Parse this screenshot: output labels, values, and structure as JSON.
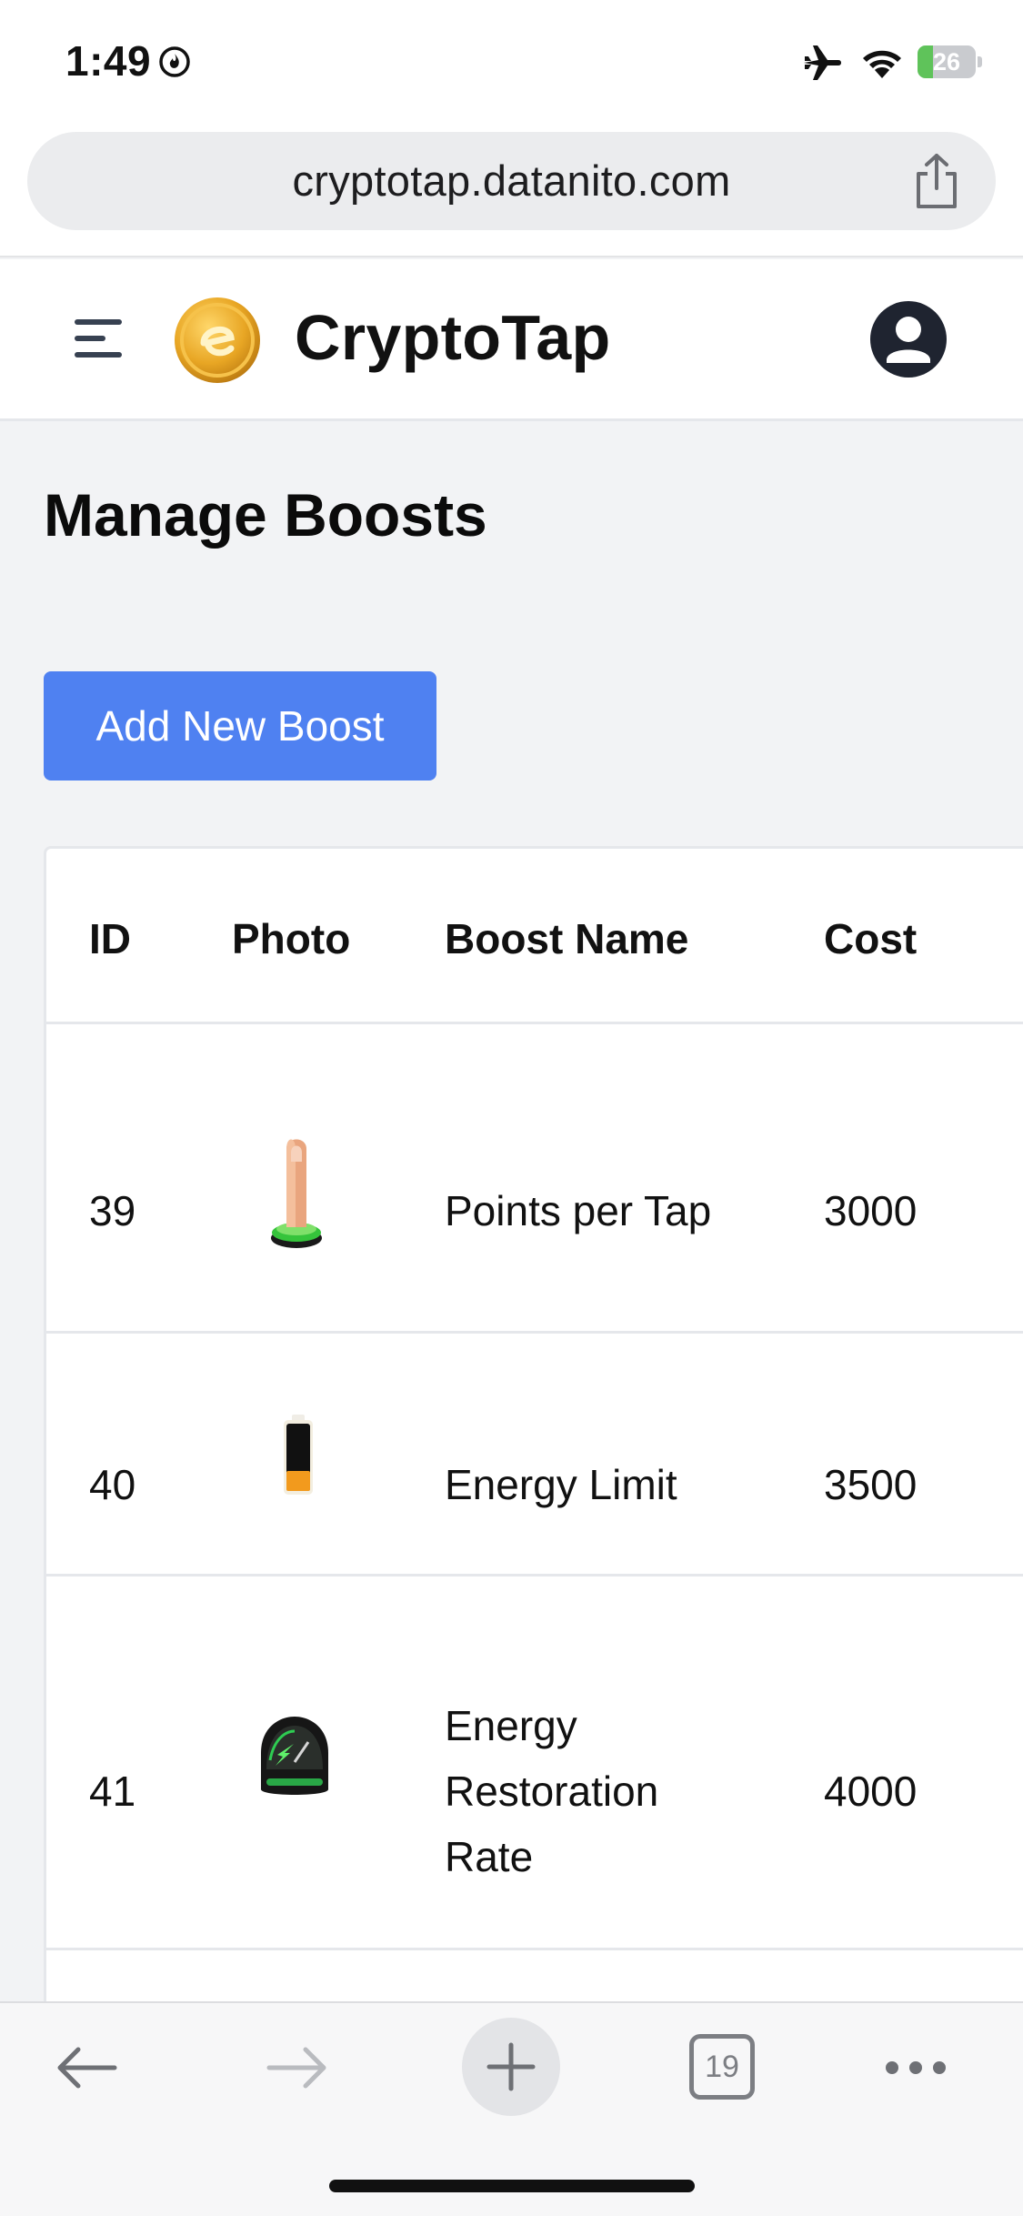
{
  "status_bar": {
    "time": "1:49",
    "battery": "26",
    "battery_level": 0.26,
    "icons": [
      "focus-icon",
      "airplane-icon",
      "wifi-icon",
      "battery-icon"
    ]
  },
  "browser": {
    "url": "cryptotap.datanito.com",
    "tabs_count": "19",
    "icons": [
      "share-icon",
      "back-arrow-icon",
      "forward-arrow-icon",
      "plus-icon",
      "tabs-icon",
      "more-icon"
    ]
  },
  "header": {
    "brand": "CryptoTap",
    "icons": [
      "menu-icon",
      "logo-coin-icon",
      "profile-icon"
    ]
  },
  "page": {
    "title": "Manage Boosts",
    "add_button": "Add New Boost"
  },
  "table": {
    "columns": [
      "ID",
      "Photo",
      "Boost Name",
      "Cost"
    ],
    "rows": [
      {
        "id": "39",
        "photo": "finger-tap-icon",
        "name": "Points per Tap",
        "cost": "3000"
      },
      {
        "id": "40",
        "photo": "battery-icon",
        "name": "Energy Limit",
        "cost": "3500"
      },
      {
        "id": "41",
        "photo": "speedometer-icon",
        "name_lines": [
          "Energy",
          "Restoration",
          "Rate"
        ],
        "cost": "4000"
      }
    ]
  },
  "colors": {
    "accent": "#4f81f1",
    "page_bg": "#f2f3f5",
    "battery_green": "#5fc35a"
  }
}
